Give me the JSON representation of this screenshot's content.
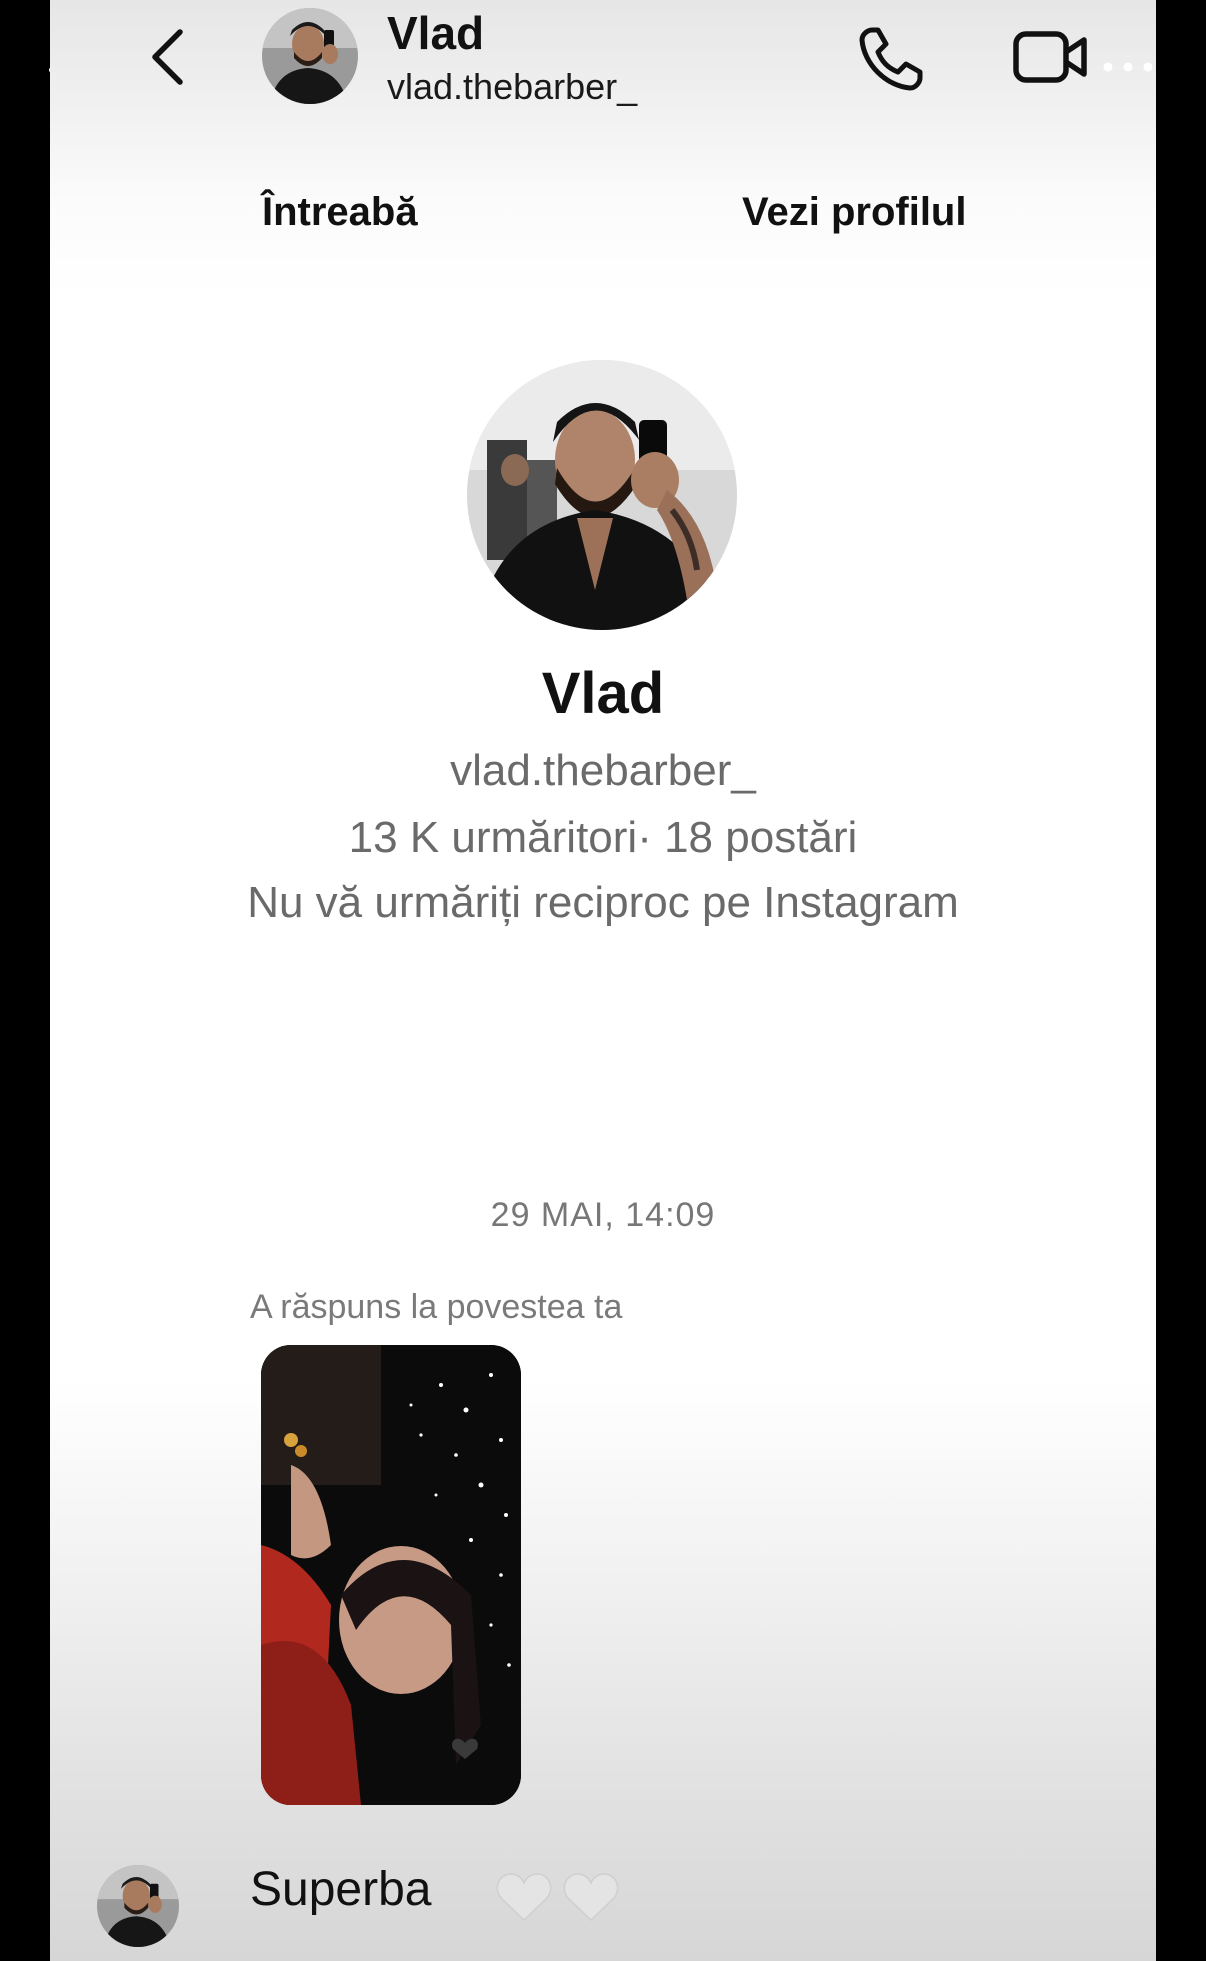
{
  "header": {
    "name": "Vlad",
    "username": "vlad.thebarber_",
    "back_icon": "chevron-left-icon",
    "call_icon": "phone-icon",
    "video_icon": "video-camera-icon",
    "more_icon": "more-dots-icon"
  },
  "actions": {
    "ask": "Întreabă",
    "view_profile": "Vezi profilul"
  },
  "profile": {
    "name": "Vlad",
    "username": "vlad.thebarber_",
    "stats": "13 K urmăritori· 18 postări",
    "mutual": "Nu vă urmăriți reciproc pe Instagram"
  },
  "chat": {
    "timestamp": "29 MAI, 14:09",
    "reply_label": "A răspuns la povestea ta",
    "message": "Superba",
    "reactions": [
      "heart-icon",
      "heart-icon"
    ]
  },
  "colors": {
    "text_primary": "#111111",
    "text_secondary": "#6a6a6a",
    "heart": "#e6e6e6"
  }
}
